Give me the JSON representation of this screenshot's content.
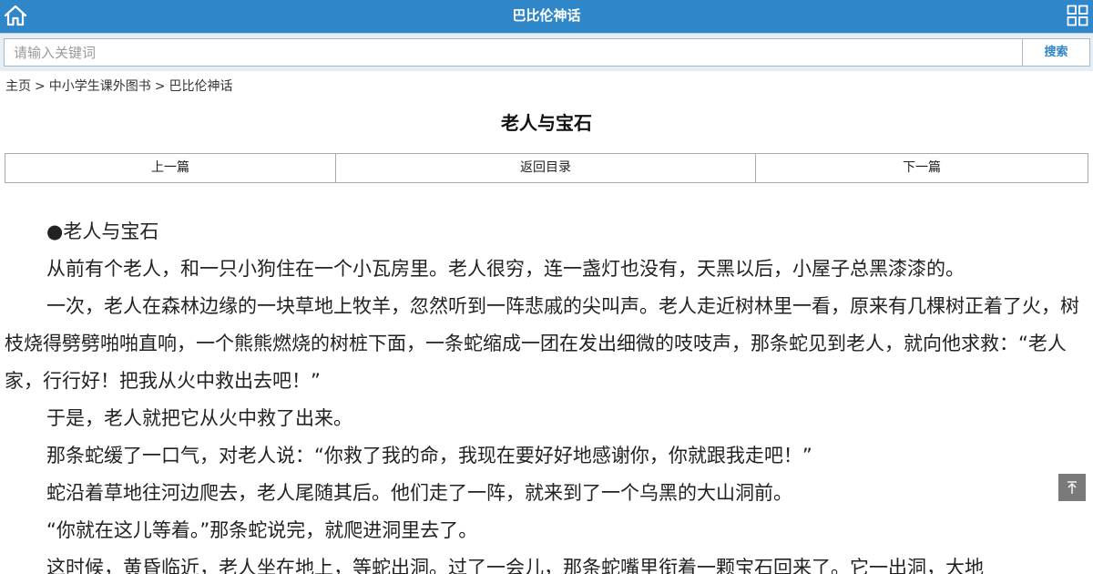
{
  "header": {
    "title": "巴比伦神话",
    "home_icon": "home-icon",
    "menu_icon": "grid-menu-icon",
    "bg_color": "#2f86c9"
  },
  "search": {
    "placeholder": "请输入关键词",
    "value": "",
    "button_label": "搜索"
  },
  "breadcrumb": {
    "items": [
      "主页",
      "中小学生课外图书",
      "巴比伦神话"
    ],
    "separator": ">"
  },
  "article": {
    "title": "老人与宝石",
    "nav": {
      "prev": "上一篇",
      "toc": "返回目录",
      "next": "下一篇"
    },
    "paragraphs": [
      "●老人与宝石",
      "从前有个老人，和一只小狗住在一个小瓦房里。老人很穷，连一盏灯也没有，天黑以后，小屋子总黑漆漆的。",
      "一次，老人在森林边缘的一块草地上牧羊，忽然听到一阵悲戚的尖叫声。老人走近树林里一看，原来有几棵树正着了火，树枝烧得劈劈啪啪直响，一个熊熊燃烧的树桩下面，一条蛇缩成一团在发出细微的吱吱声，那条蛇见到老人，就向他求救：“老人家，行行好！把我从火中救出去吧！”",
      "于是，老人就把它从火中救了出来。",
      "那条蛇缓了一口气，对老人说：“你救了我的命，我现在要好好地感谢你，你就跟我走吧！”",
      "蛇沿着草地往河边爬去，老人尾随其后。他们走了一阵，就来到了一个乌黑的大山洞前。",
      "“你就在这儿等着。”那条蛇说完，就爬进洞里去了。",
      "这时候，黄昏临近，老人坐在地上，等蛇出洞。过了一会儿，那条蛇嘴里衔着一颗宝石回来了。它一出洞，大地"
    ]
  },
  "back_to_top_icon": "arrow-up-to-top-icon"
}
